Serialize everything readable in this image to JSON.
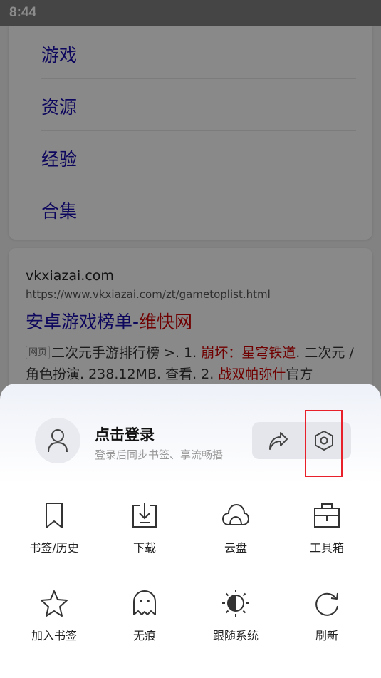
{
  "status_bar": {
    "time": "8:44"
  },
  "background_page": {
    "nav_items": [
      "游戏",
      "资源",
      "经验",
      "合集"
    ],
    "result": {
      "site": "vkxiazai.com",
      "url": "https://www.vkxiazai.com/zt/gametoplist.html",
      "title_part1": "安卓游戏榜单-",
      "title_part2": "维快网",
      "tag": "网页",
      "snippet_a": "二次元手游排行榜 >. 1. ",
      "snippet_hl1": "崩坏：星穹铁道",
      "snippet_b": ". 二次元 / 角色扮演. 238.12MB. 查看. 2. ",
      "snippet_hl2": "战双帕弥什",
      "snippet_c": "官方"
    }
  },
  "sheet": {
    "login_title": "点击登录",
    "login_subtitle": "登录后同步书签、享流畅播",
    "share_icon": "share-icon",
    "settings_icon": "settings-hexagon-icon",
    "grid": [
      {
        "label": "书签/历史",
        "icon": "bookmark-icon"
      },
      {
        "label": "下载",
        "icon": "download-icon"
      },
      {
        "label": "云盘",
        "icon": "cloud-icon"
      },
      {
        "label": "工具箱",
        "icon": "toolbox-icon"
      },
      {
        "label": "加入书签",
        "icon": "star-icon"
      },
      {
        "label": "无痕",
        "icon": "ghost-icon"
      },
      {
        "label": "跟随系统",
        "icon": "theme-auto-icon"
      },
      {
        "label": "刷新",
        "icon": "refresh-icon"
      }
    ]
  },
  "colors": {
    "highlight": "#e8202a",
    "link": "#1a0dab",
    "keyword": "#cc0000"
  }
}
